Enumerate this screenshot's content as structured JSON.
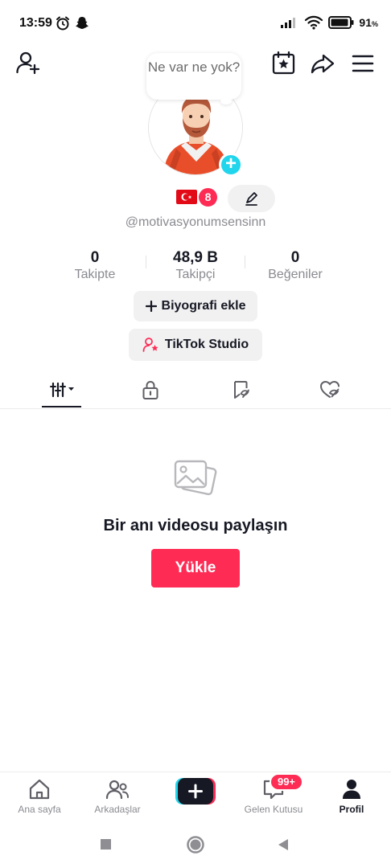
{
  "status_bar": {
    "time": "13:59",
    "battery": "91",
    "battery_unit": "%"
  },
  "profile": {
    "bubble_text": "Ne var ne yok?",
    "level": "8",
    "username": "@motivasyonumsensinn",
    "stats": [
      {
        "value": "0",
        "label": "Takipte"
      },
      {
        "value": "48,9 B",
        "label": "Takipçi"
      },
      {
        "value": "0",
        "label": "Beğeniler"
      }
    ],
    "add_bio_label": "Biyografi ekle",
    "studio_label": "TikTok Studio"
  },
  "tabs": [
    "videos-grid-icon",
    "lock-icon",
    "reposts-icon",
    "liked-icon"
  ],
  "empty_state": {
    "title": "Bir anı videosu paylaşın",
    "upload_label": "Yükle"
  },
  "bottom_nav": {
    "home": "Ana sayfa",
    "friends": "Arkadaşlar",
    "inbox": "Gelen Kutusu",
    "inbox_badge": "99+",
    "profile": "Profil"
  },
  "colors": {
    "accent": "#fe2c55",
    "cyan": "#20d5ec",
    "text": "#161823",
    "muted": "#8a8b91"
  }
}
